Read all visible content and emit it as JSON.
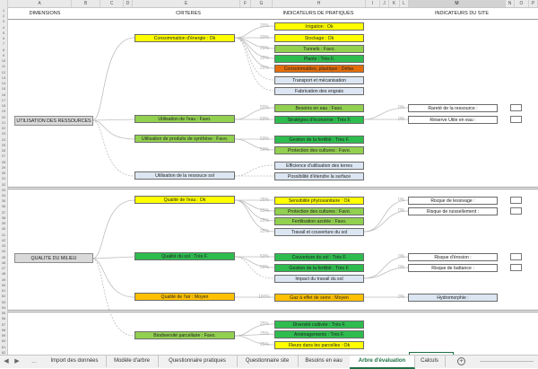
{
  "columns": [
    "A",
    "B",
    "C",
    "D",
    "E",
    "F",
    "G",
    "H",
    "I",
    "J",
    "K",
    "L",
    "M",
    "N",
    "O",
    "P"
  ],
  "selected_column": "M",
  "rows": [
    "1",
    "2",
    "3",
    "4",
    "5",
    "6",
    "7",
    "8",
    "9",
    "10",
    "11",
    "12",
    "13",
    "14",
    "15",
    "16",
    "17",
    "18",
    "19",
    "20",
    "21",
    "22",
    "23",
    "24",
    "25",
    "26",
    "27",
    "28",
    "29",
    "30",
    "31",
    "32",
    "33",
    "34",
    "35",
    "36",
    "37",
    "38",
    "39",
    "40",
    "41",
    "42",
    "43",
    "44",
    "45",
    "46",
    "47",
    "48",
    "49",
    "50",
    "51",
    "52",
    "53",
    "54",
    "55",
    "56",
    "57",
    "58",
    "59",
    "60",
    "61",
    "62"
  ],
  "headers": {
    "dimensions": "DIMENSIONS",
    "criteres": "CRITERES",
    "indicateurs_pratiques": "INDICATEURS DE PRATIQUES",
    "indicateurs_site": "INDICATEURS DU SITE"
  },
  "dimensions": [
    "UTILISATION DES RESSOURCES",
    "QUALITE DU MILIEU"
  ],
  "criteres": [
    "Consommation d'énergie : Ok",
    "Utilisation de l'eau : Favo.",
    "Utilisation de produits de synthèse : Favo.",
    "Utilisation de la ressouce sol",
    "Qualité de l'eau : Ok",
    "Qualité du sol : Très F.",
    "Qualité de l'air : Moyen",
    "Biodiversité parcellaire : Favo."
  ],
  "pratiques": [
    {
      "pct": "20%",
      "label": "Irrigation : Ok"
    },
    {
      "pct": "20%",
      "label": "Stockage : Ok"
    },
    {
      "pct": "20%",
      "label": "Tunnels : Favo."
    },
    {
      "pct": "20%",
      "label": "Plants : Très F."
    },
    {
      "pct": "20%",
      "label": "Consommables, plastique : Défav."
    },
    {
      "pct": "",
      "label": "Transport et mécanisation"
    },
    {
      "pct": "",
      "label": "Fabrication des engrais"
    },
    {
      "pct": "50%",
      "label": "Besoins en eau : Favo."
    },
    {
      "pct": "50%",
      "label": "Stratégies d'économie : Très F."
    },
    {
      "pct": "50%",
      "label": "Gestion de la fertilité : Très F."
    },
    {
      "pct": "50%",
      "label": "Protection des cultures : Favo."
    },
    {
      "pct": "",
      "label": "Efficience d'utilisation des terres"
    },
    {
      "pct": "",
      "label": "Possibilité d'étendre la surface"
    },
    {
      "pct": "25%",
      "label": "Sensibilité phytosanitaire : Ok"
    },
    {
      "pct": "25%",
      "label": "Protection des cultures : Favo."
    },
    {
      "pct": "25%",
      "label": "Fertilisation azotée : Favo."
    },
    {
      "pct": "25%",
      "label": "Travail et couverture du sol"
    },
    {
      "pct": "50%",
      "label": "Couverture du sol : Très F."
    },
    {
      "pct": "50%",
      "label": "Gestion de la fertilité : Très F."
    },
    {
      "pct": "",
      "label": "Impact du travail du sol"
    },
    {
      "pct": "100%",
      "label": "Gaz à effet de serre : Moyen"
    },
    {
      "pct": "25%",
      "label": "Diversité cultivée : Très F."
    },
    {
      "pct": "25%",
      "label": "Aménagements : Très F."
    },
    {
      "pct": "25%",
      "label": "Fleurs dans les parcelles : Ok"
    }
  ],
  "site": [
    {
      "pct": "0%",
      "label": "Rareté de la ressource :"
    },
    {
      "pct": "0%",
      "label": "Réserve Utile en eau :"
    },
    {
      "pct": "0%",
      "label": "Risque de lessivage :"
    },
    {
      "pct": "0%",
      "label": "Risque de ruissellement :"
    },
    {
      "pct": "0%",
      "label": "Risque d'érosion :"
    },
    {
      "pct": "0%",
      "label": "Risque de battance :"
    },
    {
      "pct": "0%",
      "label": "Hydromorphie :"
    }
  ],
  "tabs": {
    "nav_prev": "◀",
    "nav_next": "▶",
    "nav_more": "...",
    "items": [
      "Import des données",
      "Modèle d'arbre",
      "Questionnaire pratiques",
      "Questionnaire site",
      "Besoins en eau",
      "Arbre d'évaluation",
      "Calculs"
    ],
    "active": "Arbre d'évaluation",
    "add": "+"
  },
  "colors": {
    "ok": "#ffff00",
    "tres_favorable": "#2ebc4f",
    "favorable": "#92d050",
    "moyen": "#ffc000",
    "defavorable": "#e46c0a",
    "non_evalue": "#dce6f2"
  }
}
